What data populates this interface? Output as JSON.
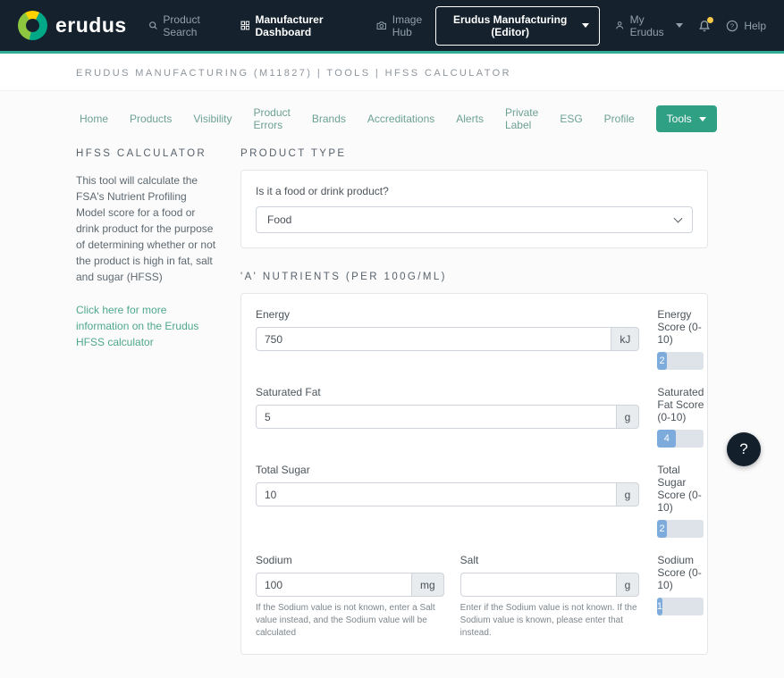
{
  "navbar": {
    "brand": "erudus",
    "product_search": "Product Search",
    "manufacturer_dashboard": "Manufacturer Dashboard",
    "image_hub": "Image Hub",
    "org_selector": "Erudus Manufacturing (Editor)",
    "my_erudus": "My Erudus",
    "help": "Help"
  },
  "breadcrumb": "ERUDUS MANUFACTURING (M11827) | TOOLS | HFSS CALCULATOR",
  "tabs": {
    "home": "Home",
    "products": "Products",
    "visibility": "Visibility",
    "product_errors": "Product Errors",
    "brands": "Brands",
    "accreditations": "Accreditations",
    "alerts": "Alerts",
    "private_label": "Private Label",
    "esg": "ESG",
    "profile": "Profile",
    "tools": "Tools"
  },
  "sidebar": {
    "title": "HFSS CALCULATOR",
    "description": "This tool will calculate the FSA's Nutrient Profiling Model score for a food or drink product for the purpose of determining whether or not the product is high in fat, salt and sugar (HFSS)",
    "link": "Click here for more information on the Erudus HFSS calculator"
  },
  "product_type": {
    "heading": "PRODUCT TYPE",
    "question": "Is it a food or drink product?",
    "selected_option": "Food"
  },
  "nutrients": {
    "heading": "'A' NUTRIENTS (PER 100G/ML)",
    "energy": {
      "label": "Energy",
      "value": "750",
      "unit": "kJ",
      "score_label": "Energy Score (0-10)",
      "score": 2
    },
    "saturated_fat": {
      "label": "Saturated Fat",
      "value": "5",
      "unit": "g",
      "score_label": "Saturated Fat Score (0-10)",
      "score": 4
    },
    "total_sugar": {
      "label": "Total Sugar",
      "value": "10",
      "unit": "g",
      "score_label": "Total Sugar Score (0-10)",
      "score": 2
    },
    "sodium": {
      "label": "Sodium",
      "value": "100",
      "unit": "mg",
      "score_label": "Sodium Score (0-10)",
      "score": 1,
      "help": "If the Sodium value is not known, enter a Salt value instead, and the Sodium value will be calculated"
    },
    "salt": {
      "label": "Salt",
      "value": "",
      "unit": "g",
      "help": "Enter if the Sodium value is not known. If the Sodium value is known, please enter that instead."
    }
  },
  "floating_help": "?",
  "colors": {
    "navbar_bg": "#15222d",
    "accent_teal": "#2fae95",
    "tools_button": "#2fa084",
    "progress_fill": "#7cabdc",
    "notification_dot": "#f7c948"
  }
}
